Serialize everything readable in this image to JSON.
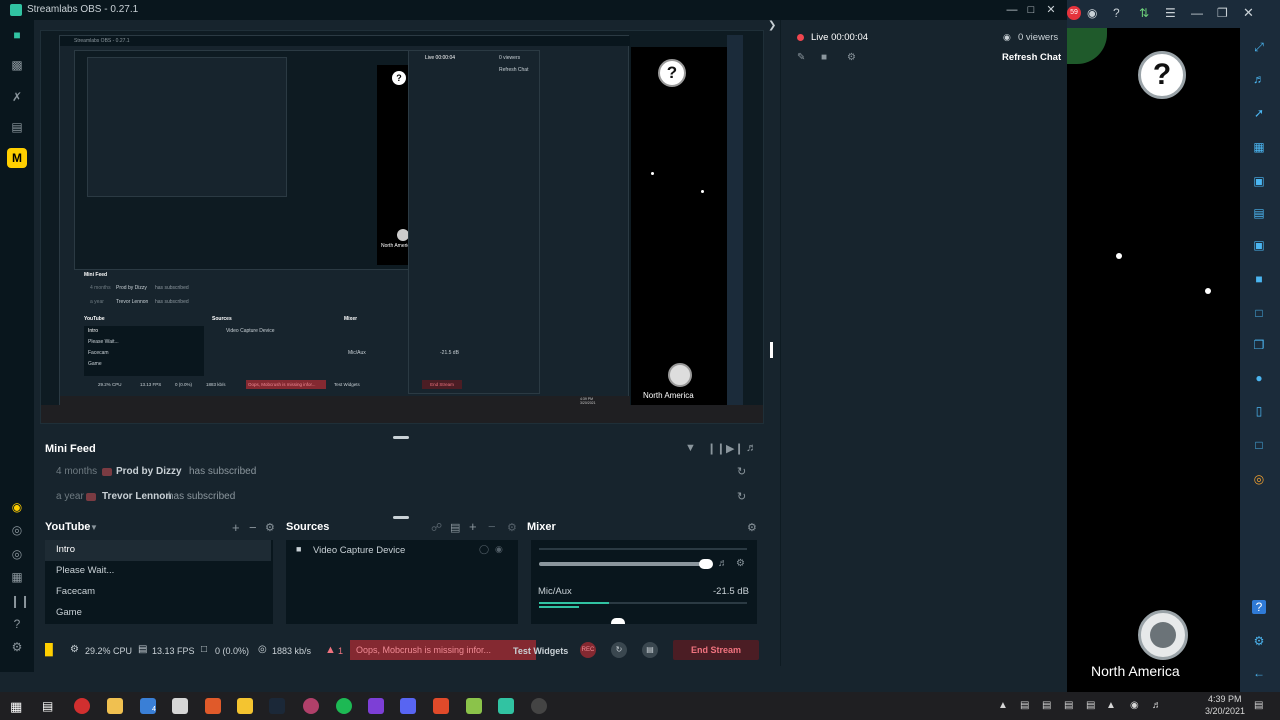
{
  "app": {
    "title": "Streamlabs OBS - 0.27.1",
    "brand_color": "#31c3a2"
  },
  "preview": {
    "nested_title": "Streamlabs OBS - 0.27.1",
    "nested_live": "Live 00:00:04",
    "nested_viewers": "0 viewers",
    "nested_refresh": "Refresh Chat",
    "nested_region": "North America",
    "nested_minifeed": "Mini Feed",
    "nested_feed_1_time": "4 months",
    "nested_feed_1_user": "Prod by Dizzy",
    "nested_feed_1_text": "has subscribed",
    "nested_feed_2_time": "a year",
    "nested_feed_2_user": "Trevor Lennon",
    "nested_feed_2_text": "has subscribed",
    "nested_scenes": "YouTube",
    "nested_scene_items": [
      "Intro",
      "Please Wait...",
      "Facecam",
      "Game"
    ],
    "nested_sources": "Sources",
    "nested_source_item": "Video Capture Device",
    "nested_mixer": "Mixer",
    "nested_mic": "Mic/Aux",
    "nested_db": "-21.5 dB",
    "nested_cpu": "29.2% CPU",
    "nested_fps": "13.13 FPS",
    "nested_drop": "0 (0.0%)",
    "nested_kbs": "1883 kb/s",
    "nested_alert": "Oops, Mobcrush is missing infor...",
    "nested_test": "Test Widgets",
    "nested_end": "End Stream",
    "nested_time": "4:39 PM",
    "nested_date": "3/20/2021"
  },
  "minifeed": {
    "title": "Mini Feed",
    "rows": [
      {
        "time": "4 months",
        "user": "Prod by Dizzy",
        "text": "has subscribed"
      },
      {
        "time": "a year",
        "user": "Trevor Lennon",
        "text": "has subscribed"
      }
    ]
  },
  "scenes": {
    "title": "YouTube",
    "items": [
      "Intro",
      "Please Wait...",
      "Facecam",
      "Game"
    ],
    "active": "Intro"
  },
  "sources": {
    "title": "Sources",
    "items": [
      "Video Capture Device"
    ]
  },
  "mixer": {
    "title": "Mixer",
    "channel": "Mic/Aux",
    "level": "-21.5 dB"
  },
  "footer": {
    "cpu": "29.2% CPU",
    "fps": "13.13 FPS",
    "dropped": "0 (0.0%)",
    "bitrate": "1883 kb/s",
    "alert_count": "1",
    "alert_text": "Oops, Mobcrush is missing infor...",
    "test_widgets": "Test Widgets",
    "rec_label": "REC",
    "end_stream": "End Stream"
  },
  "chat": {
    "live": "Live 00:00:04",
    "viewers": "0 viewers",
    "refresh": "Refresh Chat"
  },
  "emulator": {
    "region": "North America",
    "notification_count": "59"
  },
  "taskbar": {
    "time": "4:39 PM",
    "date": "3/20/2021",
    "mail_badge": "4"
  }
}
